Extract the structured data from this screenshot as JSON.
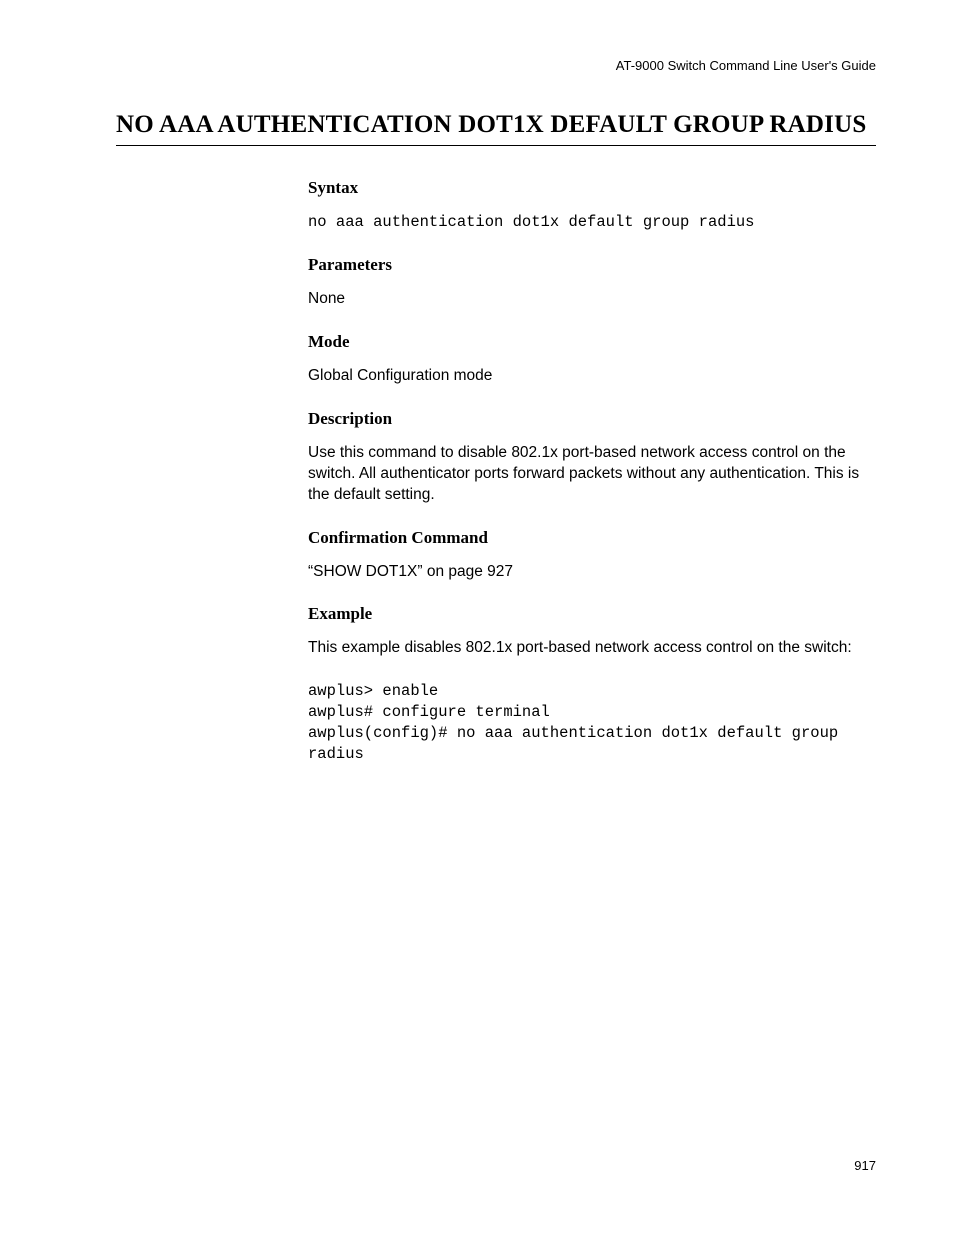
{
  "header": "AT-9000 Switch Command Line User's Guide",
  "title": "NO AAA AUTHENTICATION DOT1X DEFAULT GROUP RADIUS",
  "sections": {
    "syntax": {
      "heading": "Syntax",
      "code": "no aaa authentication dot1x default group radius"
    },
    "parameters": {
      "heading": "Parameters",
      "text": "None"
    },
    "mode": {
      "heading": "Mode",
      "text": "Global Configuration mode"
    },
    "description": {
      "heading": "Description",
      "text": "Use this command to disable 802.1x port-based network access control on the switch. All authenticator ports forward packets without any authentication. This is the default setting."
    },
    "confirmation": {
      "heading": "Confirmation Command",
      "text": "“SHOW DOT1X” on page 927"
    },
    "example": {
      "heading": "Example",
      "text": "This example disables 802.1x port-based network access control on the switch:",
      "code": "awplus> enable\nawplus# configure terminal\nawplus(config)# no aaa authentication dot1x default group radius"
    }
  },
  "page_number": "917"
}
